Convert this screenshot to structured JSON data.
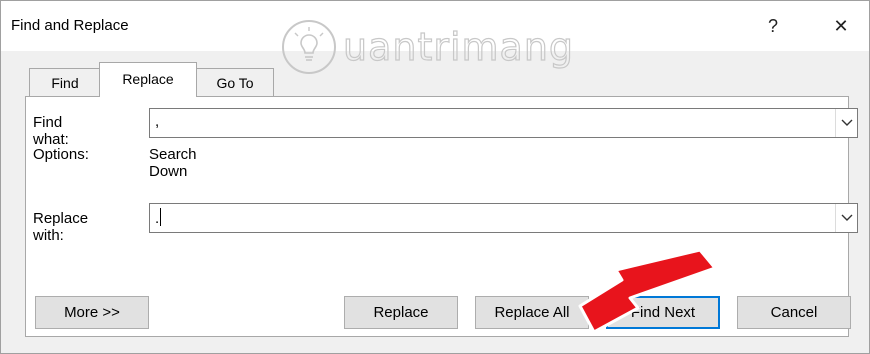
{
  "window": {
    "title": "Find and Replace",
    "help_glyph": "?",
    "close_glyph": "✕"
  },
  "watermark": {
    "text": "uantrimang"
  },
  "tabs": [
    {
      "label": "Find",
      "active": false
    },
    {
      "label": "Replace",
      "active": true
    },
    {
      "label": "Go To",
      "active": false
    }
  ],
  "find": {
    "label": "Find what:",
    "value": ","
  },
  "options": {
    "label": "Options:",
    "value": "Search Down"
  },
  "replace": {
    "label": "Replace with:",
    "value": "."
  },
  "buttons": {
    "more": "More >>",
    "replace": "Replace",
    "replace_all": "Replace All",
    "find_next": "Find Next",
    "cancel": "Cancel"
  },
  "colors": {
    "annotation_arrow": "#e8141c",
    "window_bg": "#f0f0f0",
    "panel_bg": "#ffffff"
  },
  "icons": {
    "help": "help-icon",
    "close": "close-icon",
    "dropdown": "chevron-down-icon",
    "annotation": "red-arrow-icon",
    "watermark_logo": "lightbulb-icon"
  }
}
